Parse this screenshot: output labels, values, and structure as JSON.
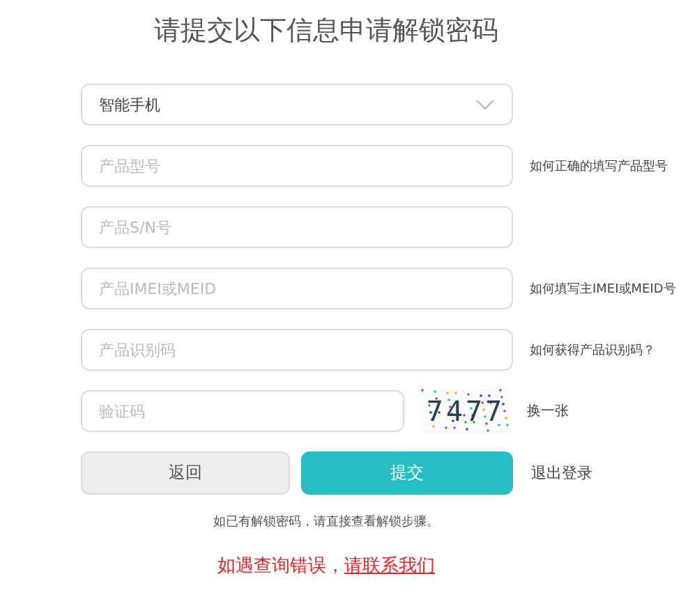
{
  "title": "请提交以下信息申请解锁密码",
  "device_select": {
    "value": "智能手机"
  },
  "fields": [
    {
      "placeholder": "产品型号",
      "help": "如何正确的填写产品型号"
    },
    {
      "placeholder": "产品S/N号"
    },
    {
      "placeholder": "产品IMEI或MEID",
      "help": "如何填写主IMEI或MEID号"
    },
    {
      "placeholder": "产品识别码",
      "help": "如何获得产品识别码？"
    }
  ],
  "captcha": {
    "placeholder": "验证码",
    "code": "7477",
    "refresh": "换一张"
  },
  "buttons": {
    "back": "返回",
    "submit": "提交",
    "logout": "退出登录"
  },
  "note": "如已有解锁密码，请直接查看解锁步骤。",
  "error_line": {
    "text": "如遇查询错误，",
    "link": "请联系我们"
  }
}
